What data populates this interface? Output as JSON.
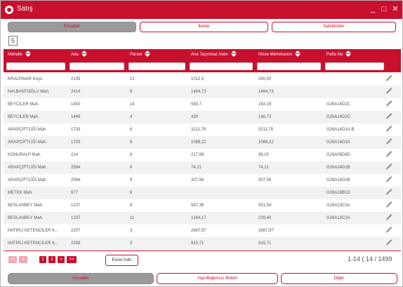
{
  "window": {
    "title": "Satış",
    "controls": [
      "_",
      "□",
      "✕"
    ]
  },
  "top_tabs": [
    {
      "label": "Emsaller",
      "active": true
    },
    {
      "label": "İlanlar",
      "active": false
    },
    {
      "label": "Sahibinden",
      "active": false
    }
  ],
  "page_box": {
    "value": "5"
  },
  "table": {
    "columns": [
      "Mahalle",
      "Ada",
      "Parsel",
      "Ana Taşınmaz Alanı",
      "Hisse Metrekaresi",
      "Pafta No"
    ],
    "rows": [
      [
        "KRALPINAR Köyü",
        "2135",
        "22",
        "1012,5",
        "430,00",
        ""
      ],
      [
        "NALBANTOĞLU Mah.",
        "2414",
        "9",
        "1484,73",
        "1484,73",
        ""
      ],
      [
        "BEYCİLER Mah.",
        "1450",
        "14",
        "583,7",
        "163,19",
        "G26A14D2C"
      ],
      [
        "BEYCİLER Mah.",
        "1449",
        "4",
        "430",
        "146,73",
        "G26A14D2C"
      ],
      [
        "ARAPÇİFTLİĞİ Mah.",
        "1733",
        "6",
        "3211,78",
        "3211,78",
        "G26A14D1A-B"
      ],
      [
        "ARAPÇİFTLİĞİ Mah.",
        "1733",
        "9",
        "1088,22",
        "1088,22",
        "G26A14D1A"
      ],
      [
        "KONURALP Mah.",
        "214",
        "6",
        "217,98",
        "98,02",
        "G26A09D4D"
      ],
      [
        "ARAPÇİFTLİĞİ Mah.",
        "2584",
        "8",
        "74,21",
        "74,21",
        "G26A14D1B"
      ],
      [
        "ARAPÇİFTLİĞİ Mah.",
        "2584",
        "9",
        "307,56",
        "307,56",
        "G26A14D1B"
      ],
      [
        "METEK Mah.",
        "677",
        "6",
        "",
        "",
        "G26A19B1D"
      ],
      [
        "BESLANBEY Mah.",
        "1237",
        "9",
        "587,36",
        "551,54",
        "G26A13C3A"
      ],
      [
        "BESLANBEY Mah.",
        "1237",
        "11",
        "1284,17",
        "239,40",
        "G26A13C3A"
      ],
      [
        "HATİPLİ KETENCİLER K...",
        "2207",
        "3",
        "2667,97",
        "2667,97",
        ""
      ],
      [
        "HATİPLİ KETENCİLER K...",
        "2208",
        "3",
        "915,71",
        "915,71",
        ""
      ]
    ]
  },
  "pager": {
    "first": "<<",
    "prev": "<",
    "page1": "1",
    "page2": "2",
    "next": ">",
    "last": ">>"
  },
  "excel_button": "Excel İndir",
  "range_text": "1-14 ( 14 / 1499",
  "bottom_tabs": [
    {
      "label": "Emsaller",
      "active": true
    },
    {
      "label": "Yapı/Bağımsız Bölüm",
      "active": false
    },
    {
      "label": "Diğer",
      "active": false
    }
  ],
  "colors": {
    "brand": "#c8102e",
    "tab_active": "#9a9a9a",
    "row_alt": "#f2f2f2"
  }
}
